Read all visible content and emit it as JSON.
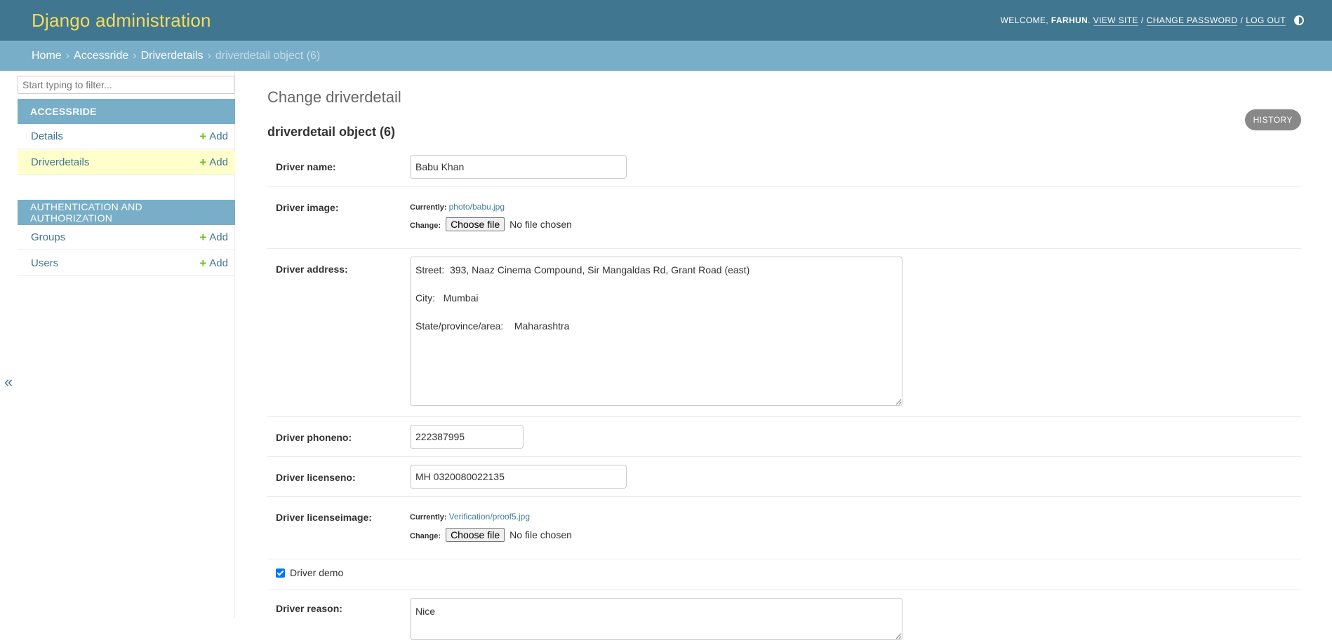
{
  "header": {
    "branding": "Django administration",
    "welcome": "Welcome,",
    "user": "Farhun",
    "view_site": "View site",
    "change_password": "Change password",
    "log_out": "Log out"
  },
  "breadcrumbs": {
    "home": "Home",
    "app": "Accessride",
    "model": "Driverdetails",
    "current": "driverdetail object (6)"
  },
  "sidebar": {
    "filter_placeholder": "Start typing to filter...",
    "modules": [
      {
        "caption": "ACCESSRIDE",
        "items": [
          {
            "label": "Details",
            "add": "Add"
          },
          {
            "label": "Driverdetails",
            "add": "Add"
          }
        ]
      },
      {
        "caption": "AUTHENTICATION AND AUTHORIZATION",
        "items": [
          {
            "label": "Groups",
            "add": "Add"
          },
          {
            "label": "Users",
            "add": "Add"
          }
        ]
      }
    ],
    "toggle": "«"
  },
  "content": {
    "title": "Change driverdetail",
    "history": "History",
    "object_title": "driverdetail object (6)",
    "fields": {
      "driver_name": {
        "label": "Driver name:",
        "value": "Babu Khan"
      },
      "driver_image": {
        "label": "Driver image:",
        "currently": "Currently:",
        "file": "photo/babu.jpg",
        "change": "Change:",
        "choose": "Choose file",
        "nofile": "No file chosen"
      },
      "driver_address": {
        "label": "Driver address:",
        "value": "Street:  393, Naaz Cinema Compound, Sir Mangaldas Rd, Grant Road (east)\n\nCity:   Mumbai\n\nState/province/area:    Maharashtra"
      },
      "driver_phoneno": {
        "label": "Driver phoneno:",
        "value": "222387995"
      },
      "driver_licenseno": {
        "label": "Driver licenseno:",
        "value": "MH 0320080022135"
      },
      "driver_licenseimage": {
        "label": "Driver licenseimage:",
        "currently": "Currently:",
        "file": "Verification/proof5.jpg",
        "change": "Change:",
        "choose": "Choose file",
        "nofile": "No file chosen"
      },
      "driver_demo": {
        "label": "Driver demo",
        "checked": true
      },
      "driver_reason": {
        "label": "Driver reason:",
        "value": "Nice"
      }
    }
  }
}
